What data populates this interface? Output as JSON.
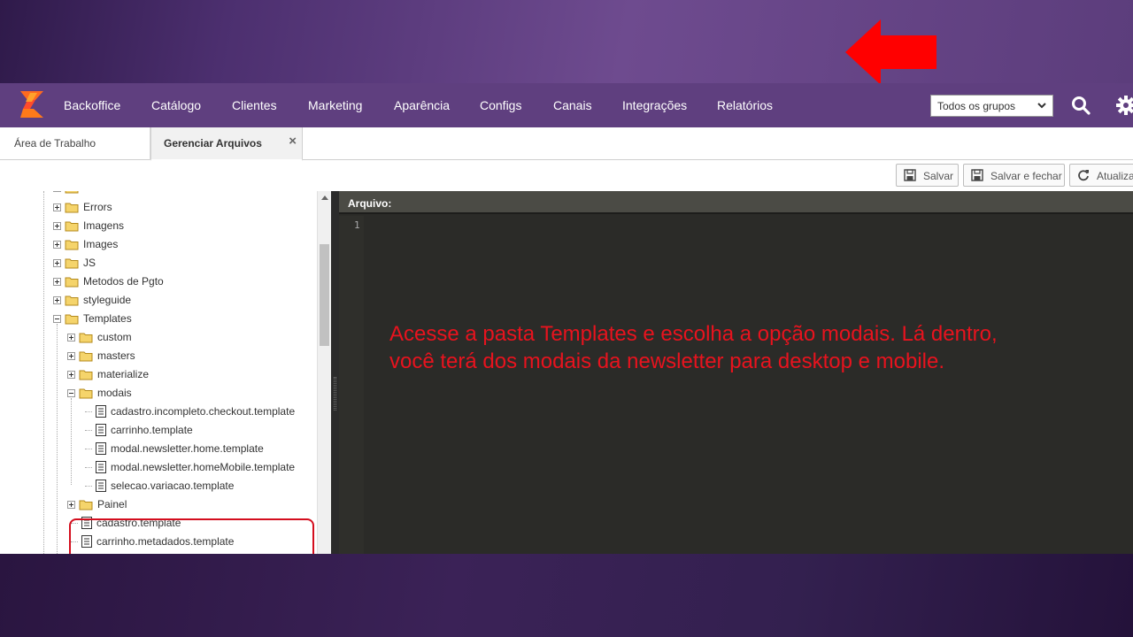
{
  "navbar": {
    "items": [
      "Backoffice",
      "Catálogo",
      "Clientes",
      "Marketing",
      "Aparência",
      "Configs",
      "Canais",
      "Integrações",
      "Relatórios"
    ],
    "group_select": "Todos os grupos"
  },
  "tabs": [
    {
      "label": "Área de Trabalho"
    },
    {
      "label": "Gerenciar Arquivos",
      "close": "×"
    }
  ],
  "toolbar": {
    "save": "Salvar",
    "save_close": "Salvar e fechar",
    "refresh": "Atualiza"
  },
  "tree": {
    "items": [
      "Errors",
      "Imagens",
      "Images",
      "JS",
      "Metodos de Pgto",
      "styleguide",
      "Templates",
      "custom",
      "masters",
      "materialize",
      "modais",
      "cadastro.incompleto.checkout.template",
      "carrinho.template",
      "modal.newsletter.home.template",
      "modal.newsletter.homeMobile.template",
      "selecao.variacao.template",
      "Painel",
      "cadastro.template",
      "carrinho.metadados.template"
    ]
  },
  "editor": {
    "header": "Arquivo:",
    "line_number": "1"
  },
  "annotation": {
    "line1": "Acesse a pasta Templates e escolha a opção modais. Lá dentro,",
    "line2": "você terá dos modais da newsletter para desktop e mobile."
  },
  "colors": {
    "navbar": "#5f3f7f",
    "annotation": "#e8131e",
    "arrow": "#ff0000",
    "editor_bg": "#2b2b28"
  },
  "icons": [
    "logo-icon",
    "search-icon",
    "gear-icon",
    "save-icon",
    "refresh-icon",
    "folder-icon",
    "file-icon",
    "left-arrow-icon"
  ]
}
